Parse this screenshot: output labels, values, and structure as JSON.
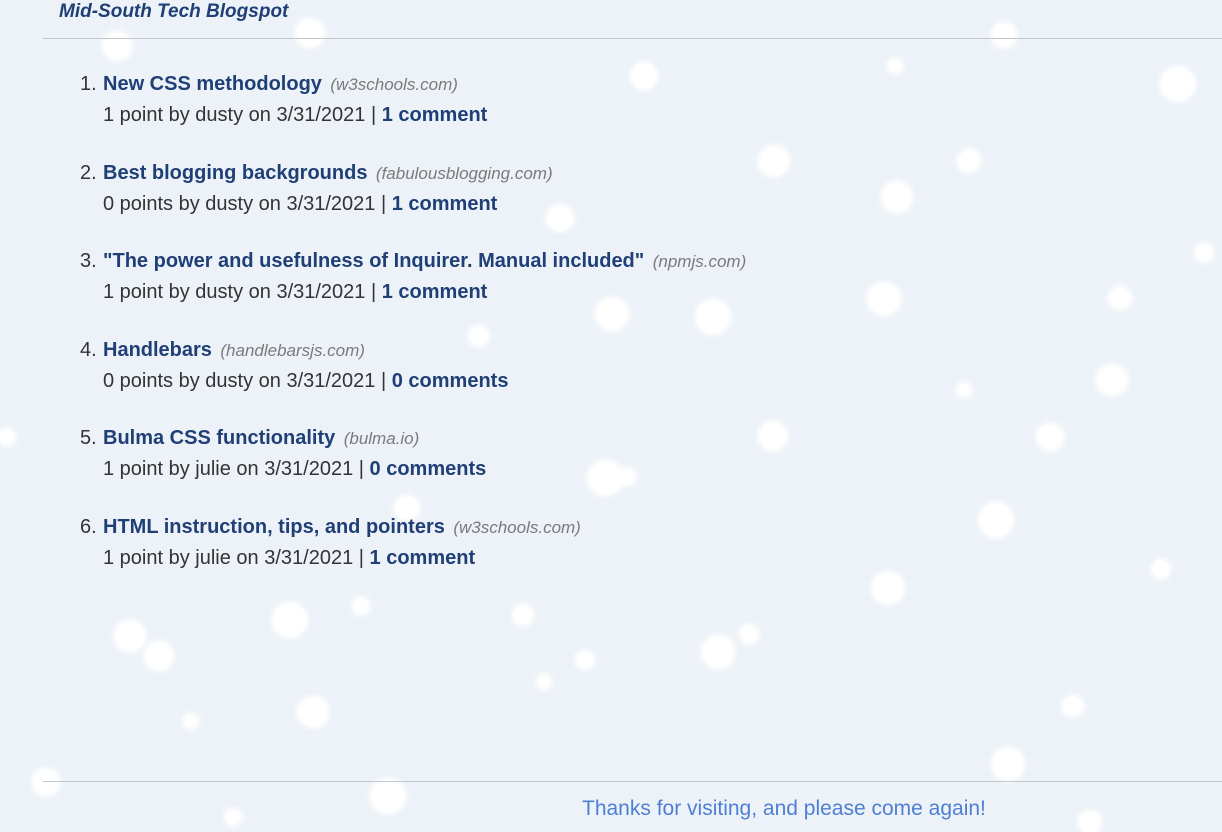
{
  "site": {
    "title": "Mid-South Tech Blogspot"
  },
  "posts": [
    {
      "number": "1.",
      "title": "New CSS methodology",
      "domain": "(w3schools.com)",
      "meta": "1 point by dusty on 3/31/2021 |",
      "comments": "1 comment"
    },
    {
      "number": "2.",
      "title": "Best blogging backgrounds",
      "domain": "(fabulousblogging.com)",
      "meta": "0 points by dusty on 3/31/2021 |",
      "comments": "1 comment"
    },
    {
      "number": "3.",
      "title": "\"The power and usefulness of Inquirer. Manual included\"",
      "domain": "(npmjs.com)",
      "meta": "1 point by dusty on 3/31/2021 |",
      "comments": "1 comment"
    },
    {
      "number": "4.",
      "title": "Handlebars",
      "domain": "(handlebarsjs.com)",
      "meta": "0 points by dusty on 3/31/2021 |",
      "comments": "0 comments"
    },
    {
      "number": "5.",
      "title": "Bulma CSS functionality",
      "domain": "(bulma.io)",
      "meta": "1 point by julie on 3/31/2021 |",
      "comments": "0 comments"
    },
    {
      "number": "6.",
      "title": "HTML instruction, tips, and pointers",
      "domain": "(w3schools.com)",
      "meta": "1 point by julie on 3/31/2021 |",
      "comments": "1 comment"
    }
  ],
  "footer": {
    "message": "Thanks for visiting, and please come again!"
  },
  "colors": {
    "background": "#ecf2f8",
    "link": "#1f3f76",
    "footer_text": "#4e7fd3",
    "domain_text": "#7a7a7a"
  },
  "background": {
    "decoration": "snowflakes"
  }
}
